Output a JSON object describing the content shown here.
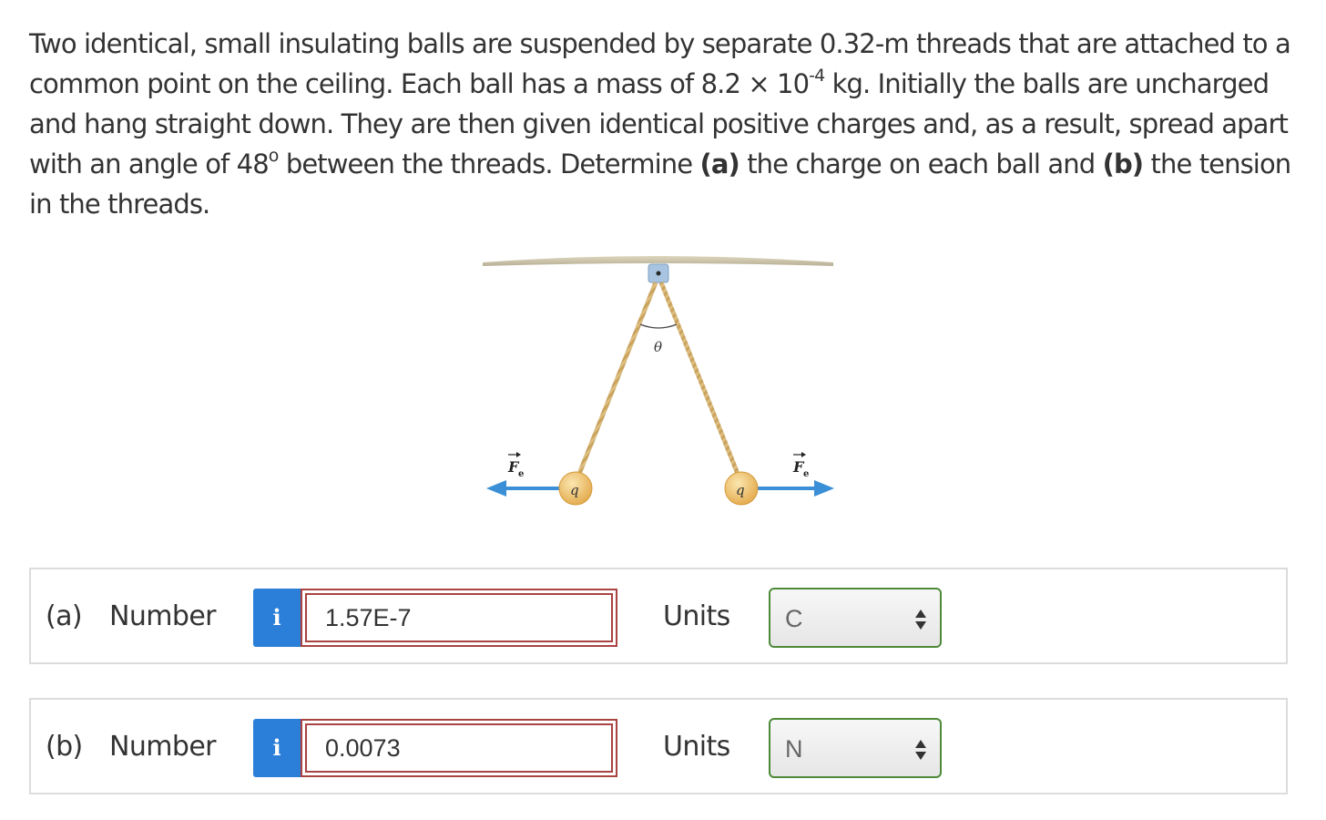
{
  "problem": {
    "text_1": "Two identical, small insulating balls are suspended by separate 0.32-m threads that are attached to a common point on the ceiling. Each ball has a mass of 8.2 × 10",
    "exponent": "-4",
    "text_2": " kg. Initially the balls are uncharged and hang straight down. They are then given identical positive charges and, as a result, spread apart with an angle of 48",
    "degree": "o",
    "text_3": " between the threads. Determine ",
    "part_a_marker": "(a)",
    "text_4": " the charge on each ball and ",
    "part_b_marker": "(b)",
    "text_5": " the tension in the threads."
  },
  "figure": {
    "angle_label": "θ",
    "charge_label": "q",
    "force_label": "F",
    "force_subscript": "e",
    "colors": {
      "ceiling": "#c9c2a8",
      "thread": "#d8b878",
      "ball": "#f0c26a",
      "arrow": "#3a8fd6",
      "bracket": "#a8c4e0"
    }
  },
  "answers": [
    {
      "part_label": "(a)",
      "number_label": "Number",
      "info_icon": "i",
      "value": "1.57E-7",
      "units_label": "Units",
      "unit": "C"
    },
    {
      "part_label": "(b)",
      "number_label": "Number",
      "info_icon": "i",
      "value": "0.0073",
      "units_label": "Units",
      "unit": "N"
    }
  ],
  "colors": {
    "info_button": "#2b7fd8",
    "error_border": "#a94442",
    "select_border": "#4e8a3a",
    "row_border": "#dcdcdc"
  }
}
